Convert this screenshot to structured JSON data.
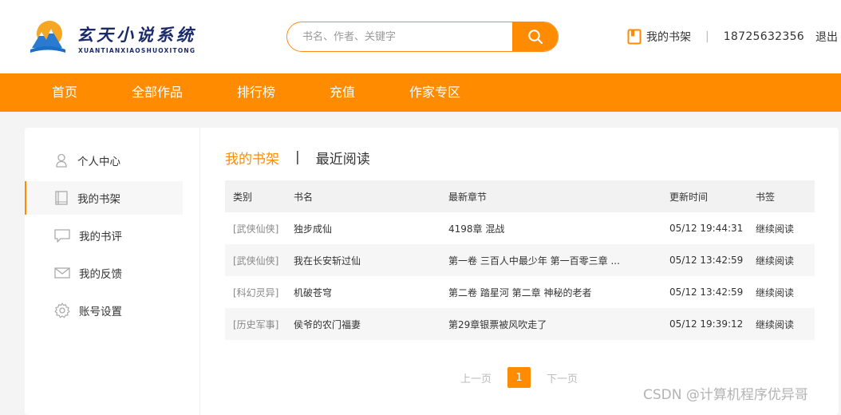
{
  "header": {
    "logo_title": "玄天小说系统",
    "logo_subtitle": "XUANTIANXIAOSHUOXITONG",
    "search_placeholder": "书名、作者、关键字",
    "shelf_link": "我的书架",
    "separator": "|",
    "phone": "18725632356",
    "logout": "退出"
  },
  "nav": {
    "items": [
      "首页",
      "全部作品",
      "排行榜",
      "充值",
      "作家专区"
    ]
  },
  "sidebar": {
    "items": [
      {
        "label": "个人中心",
        "icon": "person-icon"
      },
      {
        "label": "我的书架",
        "icon": "book-icon"
      },
      {
        "label": "我的书评",
        "icon": "comment-icon"
      },
      {
        "label": "我的反馈",
        "icon": "mail-icon"
      },
      {
        "label": "账号设置",
        "icon": "gear-icon"
      }
    ],
    "active_index": 1
  },
  "tabs": {
    "shelf": "我的书架",
    "separator": "|",
    "recent": "最近阅读"
  },
  "table": {
    "headers": [
      "类别",
      "书名",
      "最新章节",
      "更新时间",
      "书签"
    ],
    "rows": [
      {
        "category": "[武侠仙侠]",
        "name": "独步成仙",
        "chapter": "4198章 混战",
        "time": "05/12 19:44:31",
        "action": "继续阅读"
      },
      {
        "category": "[武侠仙侠]",
        "name": "我在长安斩过仙",
        "chapter": "第一卷 三百人中最少年 第一百零三章 ...",
        "time": "05/12 13:42:59",
        "action": "继续阅读"
      },
      {
        "category": "[科幻灵异]",
        "name": "机破苍穹",
        "chapter": "第二卷 踏星河 第二章 神秘的老者",
        "time": "05/12 13:42:59",
        "action": "继续阅读"
      },
      {
        "category": "[历史军事]",
        "name": "侯爷的农门福妻",
        "chapter": "第29章银票被风吹走了",
        "time": "05/12 19:39:12",
        "action": "继续阅读"
      }
    ]
  },
  "pager": {
    "prev": "上一页",
    "current": "1",
    "next": "下一页"
  },
  "watermark": "CSDN @计算机程序优异哥",
  "colors": {
    "accent": "#ff8c00",
    "brand_text": "#1b2a6b"
  }
}
